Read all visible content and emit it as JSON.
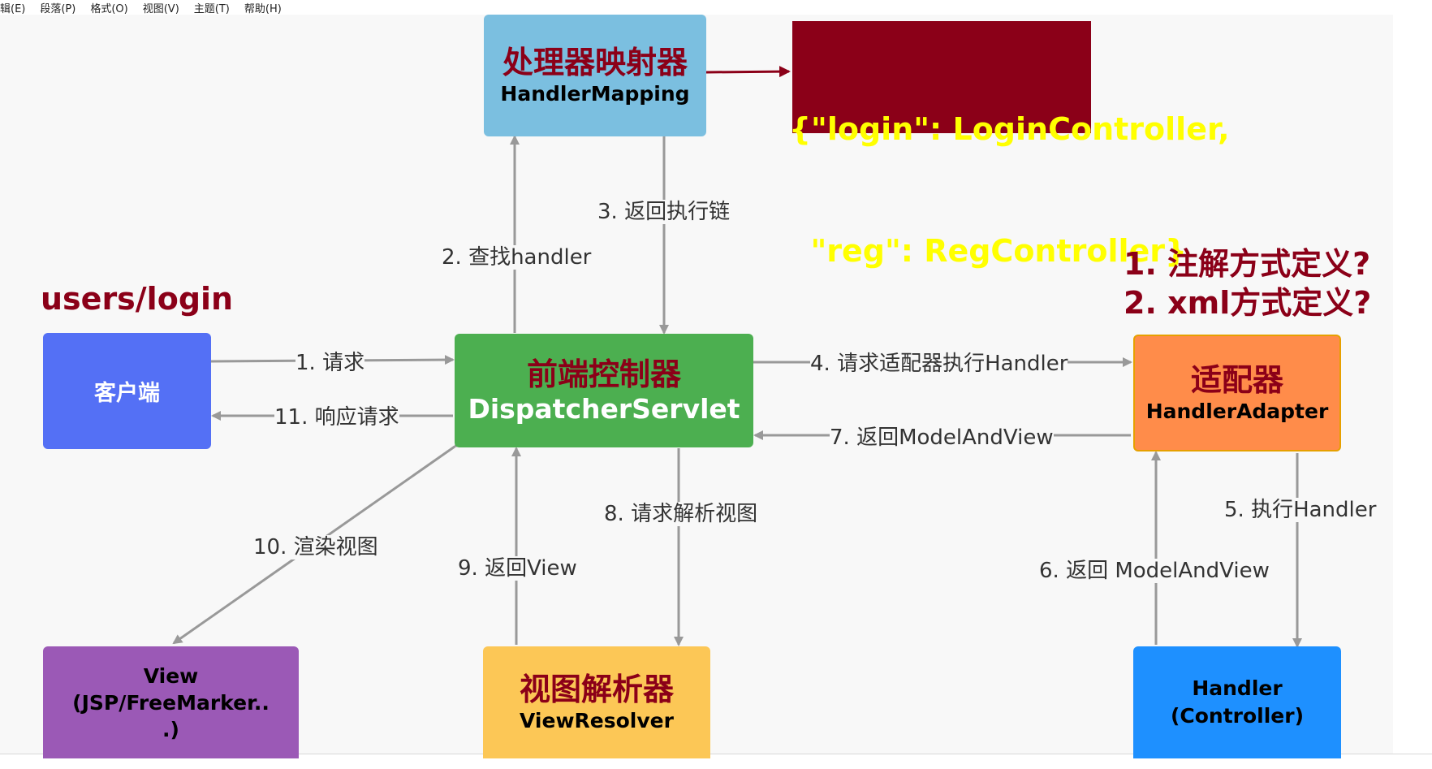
{
  "menubar": {
    "items": [
      "辑(E)",
      "段落(P)",
      "格式(O)",
      "视图(V)",
      "主题(T)",
      "帮助(H)"
    ]
  },
  "nodes": {
    "handler_mapping": {
      "cn": "处理器映射器",
      "en": "HandlerMapping",
      "color": "#7bbfe0"
    },
    "dispatcher": {
      "cn": "前端控制器",
      "en": "DispatcherServlet",
      "color": "#4caf50"
    },
    "client": {
      "label": "客户端",
      "color": "#5470f5"
    },
    "adapter": {
      "cn": "适配器",
      "en": "HandlerAdapter",
      "color": "#ff8c4a"
    },
    "view": {
      "line1": "View",
      "line2": "(JSP/FreeMarker..",
      "line3": ".)",
      "color": "#9b59b6"
    },
    "view_resolver": {
      "cn": "视图解析器",
      "en": "ViewResolver",
      "color": "#fcc756"
    },
    "handler": {
      "line1": "Handler",
      "line2": "(Controller)",
      "color": "#1e90ff"
    }
  },
  "mapping_box": {
    "line1": "{\"login\": LoginController,",
    "line2": "  \"reg\": RegController}",
    "bg": "#8b0018",
    "text_color": "#ffff00"
  },
  "notes": {
    "url": "users/login",
    "question1": "1. 注解方式定义?",
    "question2": "2. xml方式定义?"
  },
  "edges": {
    "e1": "1. 请求",
    "e2": "2. 查找handler",
    "e3": "3. 返回执行链",
    "e4": "4. 请求适配器执行Handler",
    "e5": "5. 执行Handler",
    "e6": "6. 返回 ModelAndView",
    "e7": "7. 返回ModelAndView",
    "e8": "8. 请求解析视图",
    "e9": "9. 返回View",
    "e10": "10. 渲染视图",
    "e11": "11. 响应请求"
  }
}
